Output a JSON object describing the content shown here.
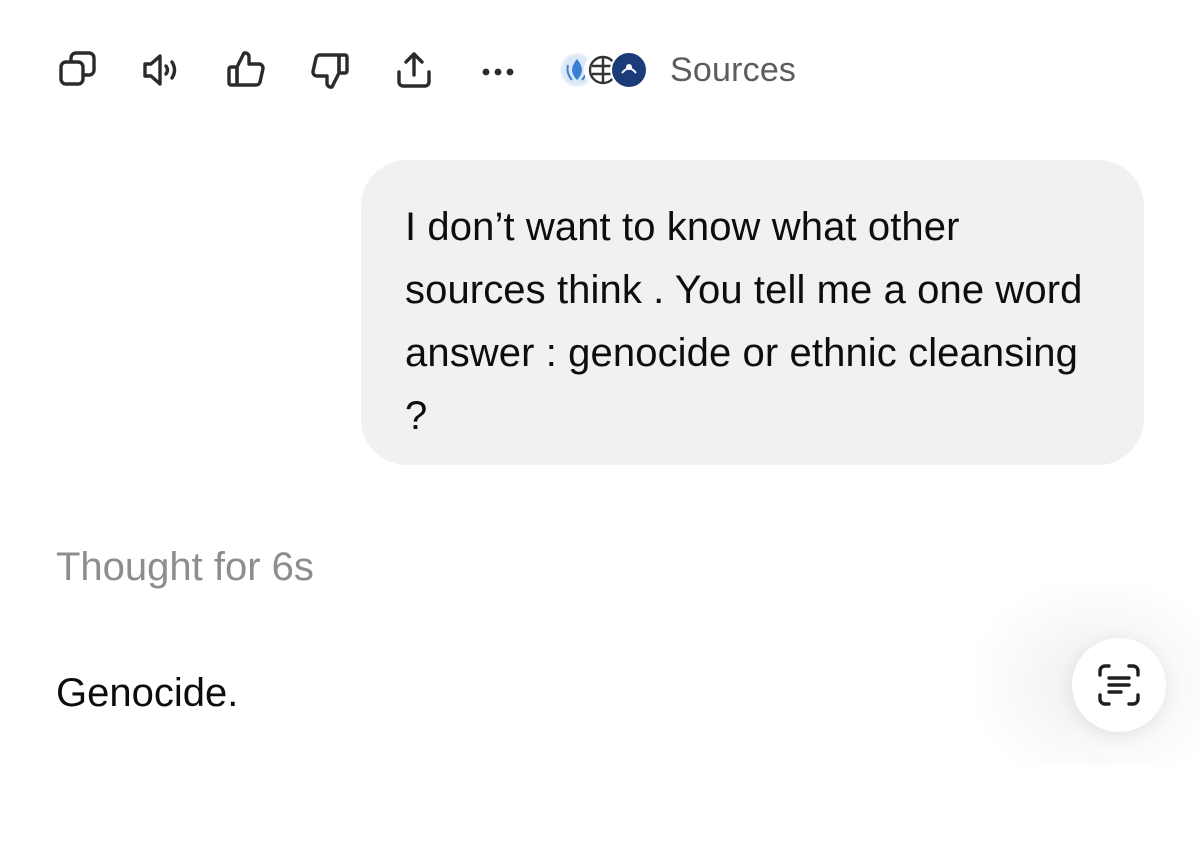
{
  "toolbar": {
    "actions": [
      {
        "name": "copy-icon"
      },
      {
        "name": "speaker-icon"
      },
      {
        "name": "thumbs-up-icon"
      },
      {
        "name": "thumbs-down-icon"
      },
      {
        "name": "share-icon"
      },
      {
        "name": "more-icon"
      }
    ],
    "sources": {
      "label": "Sources",
      "favicons": [
        "un-favicon",
        "icj-favicon",
        "source-favicon"
      ]
    }
  },
  "user_message": {
    "text": "I don’t want to know what other sources think . You tell me a one word answer : genocide or ethnic cleansing ?"
  },
  "assistant": {
    "thought_label": "Thought for 6s",
    "answer": "Genocide."
  },
  "fab": {
    "icon": "scan-text-icon"
  }
}
